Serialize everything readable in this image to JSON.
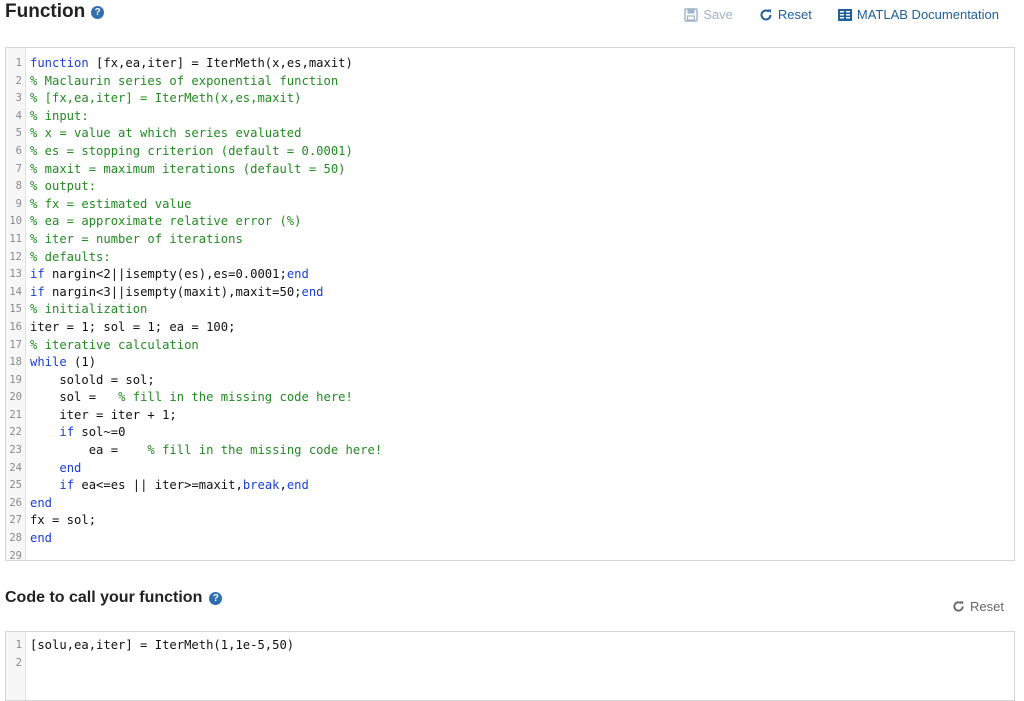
{
  "header": {
    "title": "Function",
    "save_label": "Save",
    "reset_label": "Reset",
    "docs_label": "MATLAB Documentation"
  },
  "main_code": [
    {
      "n": "1",
      "parts": [
        {
          "t": "function",
          "c": "kw"
        },
        {
          "t": " [fx,ea,iter] = IterMeth(x,es,maxit)",
          "c": ""
        }
      ]
    },
    {
      "n": "2",
      "parts": [
        {
          "t": "% Maclaurin series of exponential function",
          "c": "cm"
        }
      ]
    },
    {
      "n": "3",
      "parts": [
        {
          "t": "% [fx,ea,iter] = IterMeth(x,es,maxit)",
          "c": "cm"
        }
      ]
    },
    {
      "n": "4",
      "parts": [
        {
          "t": "% input:",
          "c": "cm"
        }
      ]
    },
    {
      "n": "5",
      "parts": [
        {
          "t": "% x = value at which series evaluated",
          "c": "cm"
        }
      ]
    },
    {
      "n": "6",
      "parts": [
        {
          "t": "% es = stopping criterion (default = 0.0001)",
          "c": "cm"
        }
      ]
    },
    {
      "n": "7",
      "parts": [
        {
          "t": "% maxit = maximum iterations (default = 50)",
          "c": "cm"
        }
      ]
    },
    {
      "n": "8",
      "parts": [
        {
          "t": "% output:",
          "c": "cm"
        }
      ]
    },
    {
      "n": "9",
      "parts": [
        {
          "t": "% fx = estimated value",
          "c": "cm"
        }
      ]
    },
    {
      "n": "10",
      "parts": [
        {
          "t": "% ea = approximate relative error (%)",
          "c": "cm"
        }
      ]
    },
    {
      "n": "11",
      "parts": [
        {
          "t": "% iter = number of iterations",
          "c": "cm"
        }
      ]
    },
    {
      "n": "12",
      "parts": [
        {
          "t": "% defaults:",
          "c": "cm"
        }
      ]
    },
    {
      "n": "13",
      "parts": [
        {
          "t": "if",
          "c": "kw"
        },
        {
          "t": " nargin<2||isempty(es),es=0.0001;",
          "c": ""
        },
        {
          "t": "end",
          "c": "kw"
        }
      ]
    },
    {
      "n": "14",
      "parts": [
        {
          "t": "if",
          "c": "kw"
        },
        {
          "t": " nargin<3||isempty(maxit),maxit=50;",
          "c": ""
        },
        {
          "t": "end",
          "c": "kw"
        }
      ]
    },
    {
      "n": "15",
      "parts": [
        {
          "t": "% initialization",
          "c": "cm"
        }
      ]
    },
    {
      "n": "16",
      "parts": [
        {
          "t": "iter = 1; sol = 1; ea = 100;",
          "c": ""
        }
      ]
    },
    {
      "n": "17",
      "parts": [
        {
          "t": "% iterative calculation",
          "c": "cm"
        }
      ]
    },
    {
      "n": "18",
      "parts": [
        {
          "t": "while",
          "c": "kw"
        },
        {
          "t": " (1)",
          "c": ""
        }
      ]
    },
    {
      "n": "19",
      "parts": [
        {
          "t": "    solold = sol;",
          "c": ""
        }
      ]
    },
    {
      "n": "20",
      "parts": [
        {
          "t": "    sol =   ",
          "c": ""
        },
        {
          "t": "% fill in the missing code here!",
          "c": "cm"
        }
      ]
    },
    {
      "n": "21",
      "parts": [
        {
          "t": "    iter = iter + 1;",
          "c": ""
        }
      ]
    },
    {
      "n": "22",
      "parts": [
        {
          "t": "    ",
          "c": ""
        },
        {
          "t": "if",
          "c": "kw"
        },
        {
          "t": " sol~=0",
          "c": ""
        }
      ]
    },
    {
      "n": "23",
      "parts": [
        {
          "t": "        ea =    ",
          "c": ""
        },
        {
          "t": "% fill in the missing code here!",
          "c": "cm"
        }
      ]
    },
    {
      "n": "24",
      "parts": [
        {
          "t": "    ",
          "c": ""
        },
        {
          "t": "end",
          "c": "kw"
        }
      ]
    },
    {
      "n": "25",
      "parts": [
        {
          "t": "    ",
          "c": ""
        },
        {
          "t": "if",
          "c": "kw"
        },
        {
          "t": " ea<=es || iter>=maxit,",
          "c": ""
        },
        {
          "t": "break",
          "c": "kw"
        },
        {
          "t": ",",
          "c": ""
        },
        {
          "t": "end",
          "c": "kw"
        }
      ]
    },
    {
      "n": "26",
      "parts": [
        {
          "t": "end",
          "c": "kw"
        }
      ]
    },
    {
      "n": "27",
      "parts": [
        {
          "t": "fx = sol;",
          "c": ""
        }
      ]
    },
    {
      "n": "28",
      "parts": [
        {
          "t": "end",
          "c": "kw"
        }
      ]
    },
    {
      "n": "29",
      "parts": []
    }
  ],
  "call_section": {
    "title": "Code to call your function",
    "reset_label": "Reset"
  },
  "call_code": [
    {
      "n": "1",
      "parts": [
        {
          "t": "[solu,ea,iter] = IterMeth(1,1e-5,50)",
          "c": ""
        }
      ]
    },
    {
      "n": "2",
      "parts": []
    }
  ],
  "colors": {
    "keyword": "#1a3fd1",
    "comment": "#228b22",
    "link": "#1f5f9c",
    "help": "#2f6fb0"
  }
}
